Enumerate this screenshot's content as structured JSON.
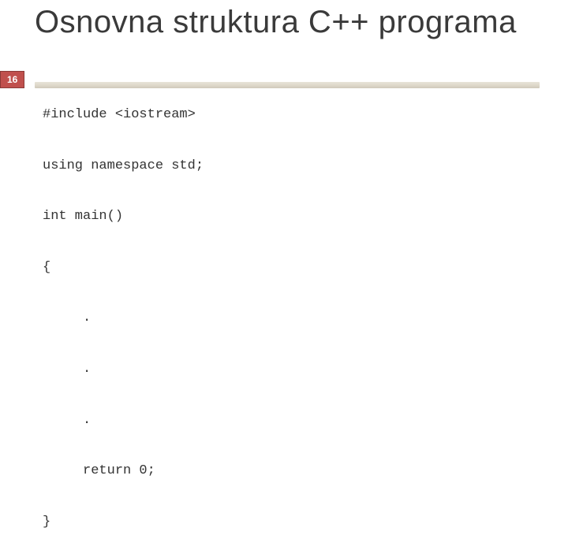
{
  "page_number": "16",
  "title": "Osnovna struktura C++\nprograma",
  "code_lines": {
    "l1": "#include <iostream>",
    "l2": "using namespace std;",
    "l3": "int main()",
    "l4": "{",
    "l5": "     .",
    "l6": "     .",
    "l7": "     .",
    "l8": "     return 0;",
    "l9": "}"
  }
}
